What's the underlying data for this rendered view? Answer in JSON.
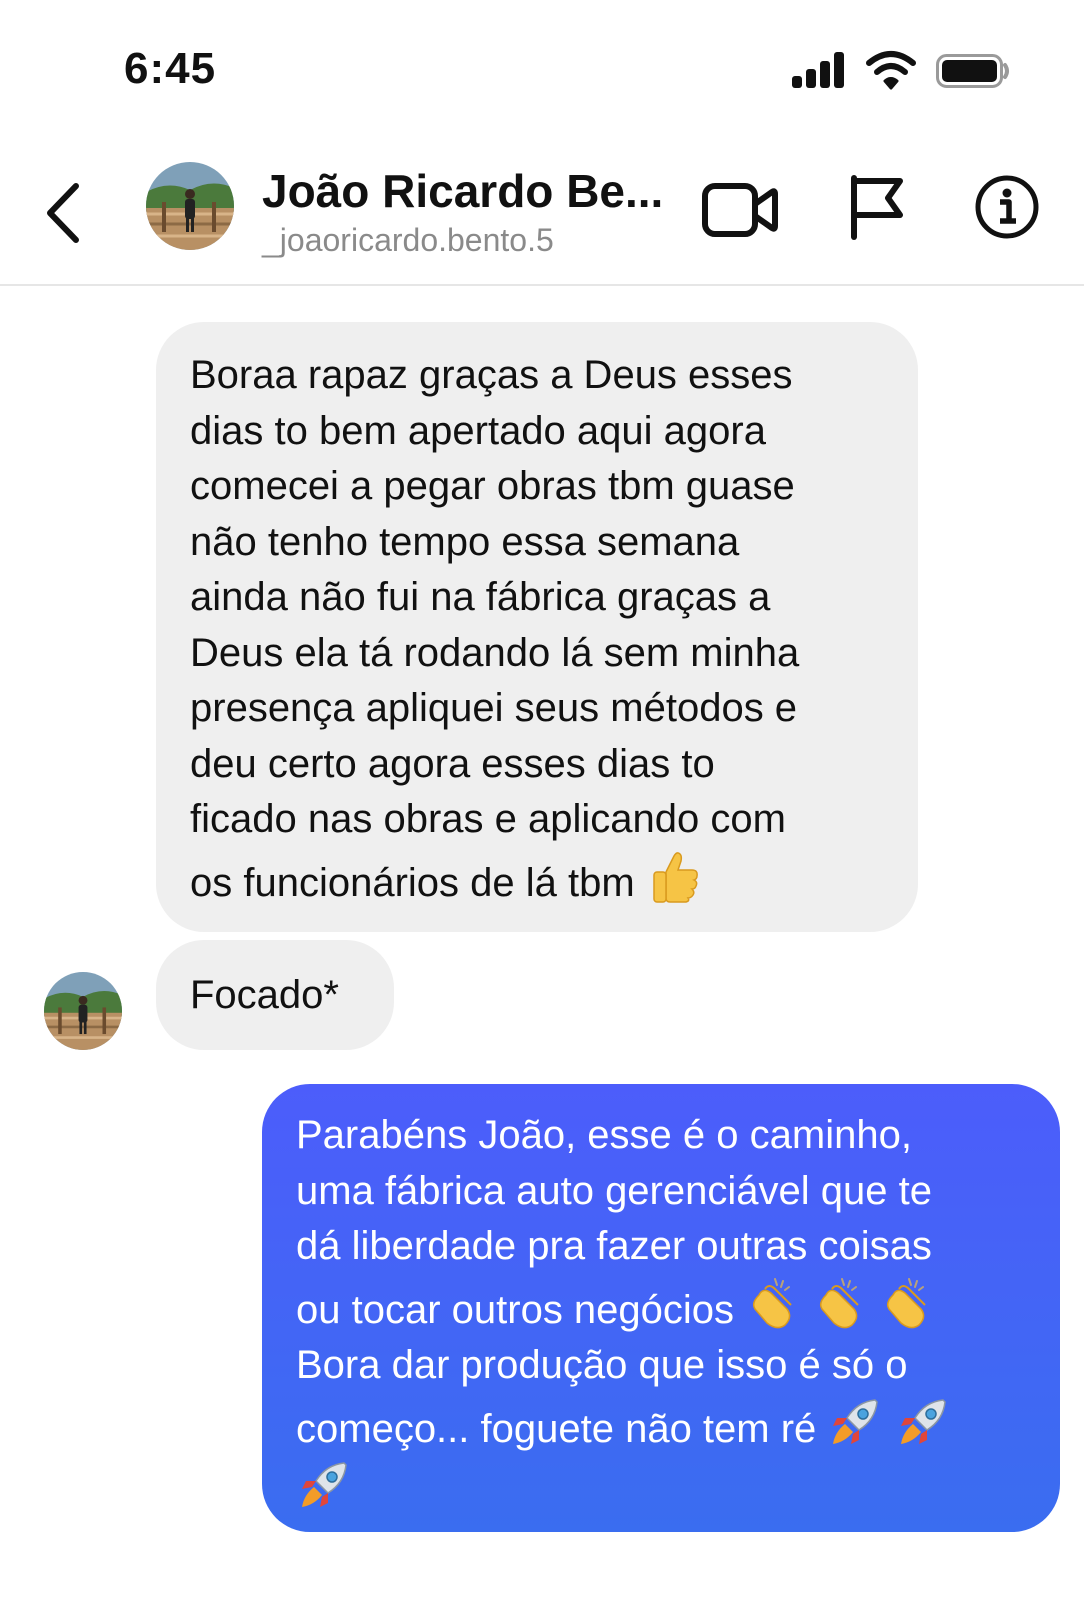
{
  "status_bar": {
    "time": "6:45"
  },
  "header": {
    "contact_name": "João Ricardo Be...",
    "contact_handle": "_joaoricardo.bento.5",
    "icons": [
      "back-icon",
      "video-call-icon",
      "flag-icon",
      "info-icon"
    ]
  },
  "messages": [
    {
      "direction": "incoming",
      "lines": [
        "Boraa rapaz graças a Deus esses",
        "dias to bem apertado aqui agora",
        "comecei a pegar obras tbm guase",
        "não tenho tempo essa semana",
        "ainda não fui na fábrica graças a",
        "Deus ela tá rodando lá sem minha",
        "presença apliquei seus métodos e",
        "deu certo agora esses dias to",
        "ficado nas obras e aplicando com",
        "os funcionários de lá tbm"
      ],
      "emoji": [
        "thumbs-up"
      ]
    },
    {
      "direction": "incoming",
      "text": "Focado*"
    },
    {
      "direction": "outgoing",
      "lines": [
        "Parabéns João, esse é o caminho,",
        "uma fábrica auto gerenciável que te",
        "dá liberdade pra fazer outras coisas",
        "ou tocar outros negócios",
        "Bora dar produção que isso é só o",
        "começo... foguete não tem ré"
      ],
      "emoji": [
        "clapping-hands",
        "clapping-hands",
        "clapping-hands",
        "rocket",
        "rocket",
        "rocket"
      ]
    }
  ],
  "colors": {
    "incoming_bubble": "#efefef",
    "outgoing_bubble_top": "#4c5dfb",
    "outgoing_bubble_bottom": "#3a6df0",
    "handle_text": "#8a8a8a"
  }
}
